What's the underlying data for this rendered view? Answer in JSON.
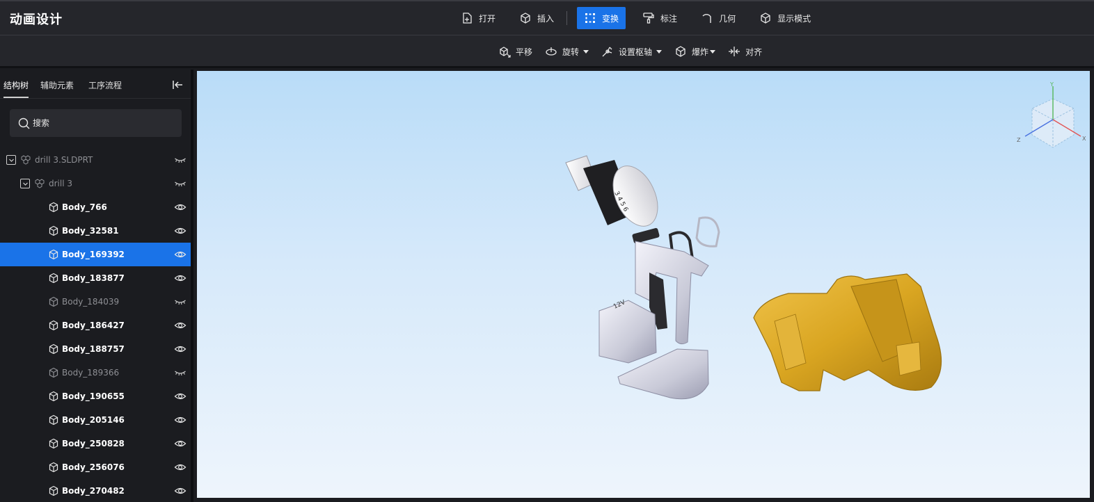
{
  "app": {
    "title": "动画设计"
  },
  "menu": [
    {
      "label": "打开",
      "icon": "file-add-icon"
    },
    {
      "label": "插入",
      "icon": "cube-insert-icon"
    },
    {
      "label": "变换",
      "icon": "transform-icon",
      "active": true
    },
    {
      "label": "标注",
      "icon": "paint-roller-icon"
    },
    {
      "label": "几何",
      "icon": "arc-icon"
    },
    {
      "label": "显示模式",
      "icon": "cube-icon"
    }
  ],
  "tools": [
    {
      "label": "平移",
      "icon": "move-cube-icon",
      "dropdown": false
    },
    {
      "label": "旋转",
      "icon": "rotate-icon",
      "dropdown": true
    },
    {
      "label": "设置枢轴",
      "icon": "pivot-icon",
      "dropdown": true
    },
    {
      "label": "爆炸",
      "icon": "explode-icon",
      "dropdown": true
    },
    {
      "label": "对齐",
      "icon": "align-icon",
      "dropdown": false
    }
  ],
  "sidebar": {
    "tabs": [
      "结构树",
      "辅助元素",
      "工序流程"
    ],
    "active_tab": 0,
    "search_placeholder": "搜索",
    "tree": [
      {
        "label": "drill 3.SLDPRT",
        "level": 0,
        "type": "assembly",
        "expanded": true,
        "visible": false
      },
      {
        "label": "drill 3",
        "level": 1,
        "type": "assembly",
        "expanded": true,
        "visible": false
      },
      {
        "label": "Body_766",
        "level": 2,
        "type": "body",
        "visible": true
      },
      {
        "label": "Body_32581",
        "level": 2,
        "type": "body",
        "visible": true
      },
      {
        "label": "Body_169392",
        "level": 2,
        "type": "body",
        "visible": true,
        "selected": true
      },
      {
        "label": "Body_183877",
        "level": 2,
        "type": "body",
        "visible": true
      },
      {
        "label": "Body_184039",
        "level": 2,
        "type": "body",
        "visible": false
      },
      {
        "label": "Body_186427",
        "level": 2,
        "type": "body",
        "visible": true
      },
      {
        "label": "Body_188757",
        "level": 2,
        "type": "body",
        "visible": true
      },
      {
        "label": "Body_189366",
        "level": 2,
        "type": "body",
        "visible": false
      },
      {
        "label": "Body_190655",
        "level": 2,
        "type": "body",
        "visible": true
      },
      {
        "label": "Body_205146",
        "level": 2,
        "type": "body",
        "visible": true
      },
      {
        "label": "Body_250828",
        "level": 2,
        "type": "body",
        "visible": true
      },
      {
        "label": "Body_256076",
        "level": 2,
        "type": "body",
        "visible": true
      },
      {
        "label": "Body_270482",
        "level": 2,
        "type": "body",
        "visible": true
      }
    ]
  },
  "viewport": {
    "chuck_label": "3 4 5 6",
    "battery_label": "12V",
    "axes": [
      "X",
      "Y",
      "Z"
    ],
    "colors": {
      "housing": "#d9a521",
      "parts": "#c9cad8",
      "selected": "#1a73e8"
    }
  }
}
